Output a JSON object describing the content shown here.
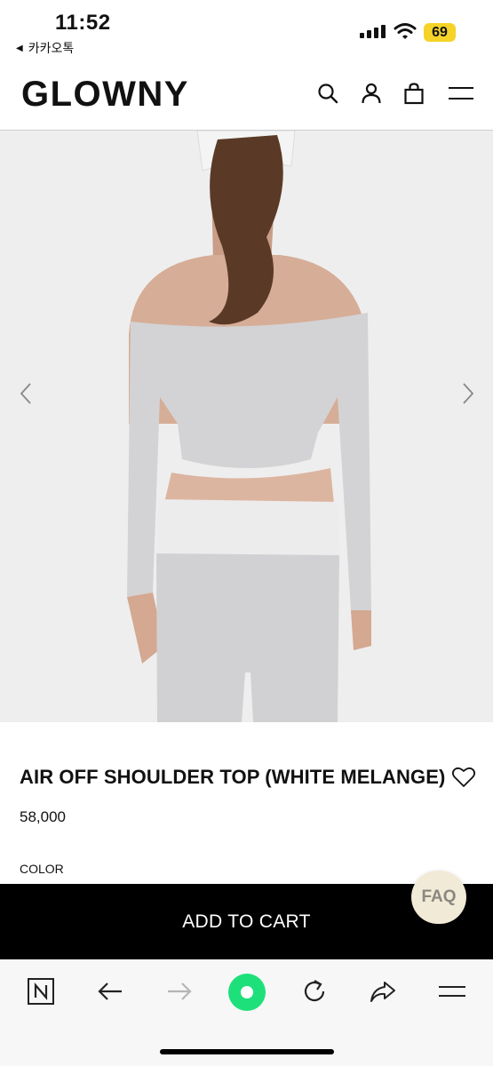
{
  "status_bar": {
    "time": "11:52",
    "back_app": "카카오톡",
    "battery": "69"
  },
  "header": {
    "logo": "GLOWNY",
    "icons": [
      "search-icon",
      "user-icon",
      "bag-icon",
      "menu-icon"
    ]
  },
  "product": {
    "title": "AIR OFF SHOULDER TOP (WHITE MELANGE)",
    "price": "58,000",
    "color_label": "COLOR"
  },
  "cta": {
    "add_to_cart": "ADD TO CART",
    "faq": "FAQ"
  },
  "browser_bar": {
    "icons": [
      "naver-icon",
      "back-arrow-icon",
      "forward-arrow-icon",
      "green-home-icon",
      "reload-icon",
      "share-icon",
      "menu-icon"
    ]
  },
  "colors": {
    "cta_background": "#000000",
    "faq_bubble": "#f1ead7",
    "battery": "#f5d328",
    "browser_center": "#1ee07a"
  }
}
